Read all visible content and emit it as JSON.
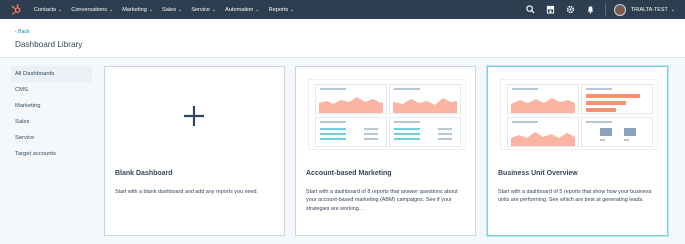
{
  "topnav": {
    "items": [
      {
        "label": "Contacts"
      },
      {
        "label": "Conversations"
      },
      {
        "label": "Marketing"
      },
      {
        "label": "Sales"
      },
      {
        "label": "Service"
      },
      {
        "label": "Automation"
      },
      {
        "label": "Reports"
      }
    ],
    "account_name": "TRIALTA-TEST",
    "icons": [
      "search-icon",
      "marketplace-icon",
      "settings-icon",
      "notifications-icon"
    ]
  },
  "header": {
    "back_label": "‹ Back",
    "title": "Dashboard Library"
  },
  "sidebar": {
    "items": [
      {
        "label": "All Dashboards",
        "active": true
      },
      {
        "label": "CMS"
      },
      {
        "label": "Marketing"
      },
      {
        "label": "Sales"
      },
      {
        "label": "Service"
      },
      {
        "label": "Target accounts"
      }
    ]
  },
  "cards": [
    {
      "title": "Blank Dashboard",
      "description": "Start with a blank dashboard and add any reports you need."
    },
    {
      "title": "Account-based Marketing",
      "description": "Start with a dashboard of 8 reports that answer questions about your account-based marketing (ABM) campaigns. See if your strategies are working…"
    },
    {
      "title": "Business Unit Overview",
      "description": "Start with a dashboard of 5 reports that show how your business units are performing. See which are best at generating leads."
    }
  ],
  "colors": {
    "nav_bg": "#2d3e50",
    "brand_orange": "#ff7a59",
    "chart_salmon": "#f9b4a2",
    "chart_teal": "#6ccfdc",
    "chart_blue": "#8ba3bf",
    "selected_border": "#7fd1de"
  }
}
